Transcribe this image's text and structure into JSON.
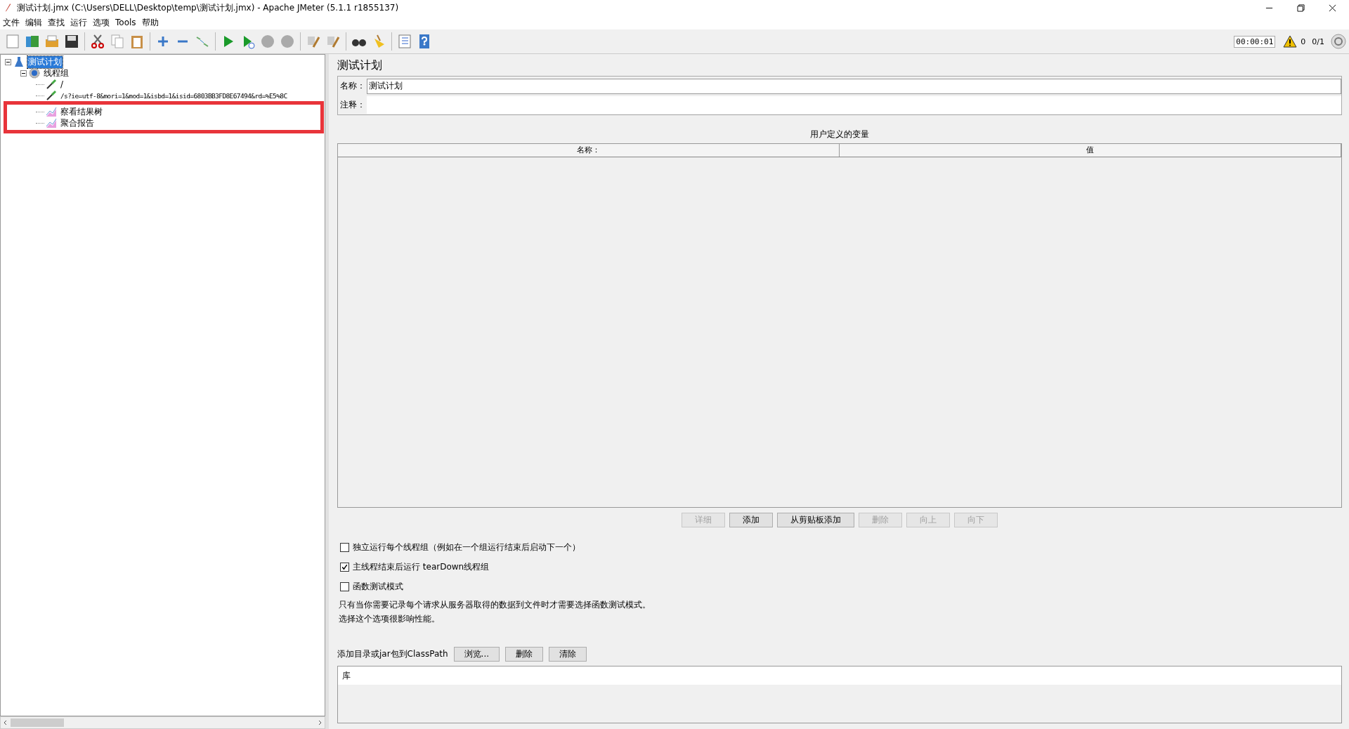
{
  "window": {
    "title": "测试计划.jmx (C:\\Users\\DELL\\Desktop\\temp\\测试计划.jmx) - Apache JMeter (5.1.1 r1855137)"
  },
  "menu": [
    "文件",
    "编辑",
    "查找",
    "运行",
    "选项",
    "Tools",
    "帮助"
  ],
  "status": {
    "timer": "00:00:01",
    "warnings": "0",
    "threads": "0/1"
  },
  "tree": [
    {
      "label": "测试计划",
      "kind": "plan",
      "selected": true,
      "expanded": true,
      "children": [
        {
          "label": "线程组",
          "kind": "threadgroup",
          "selected": false,
          "expanded": true,
          "children": [
            {
              "label": "/",
              "kind": "sampler",
              "selected": false
            },
            {
              "label": "/s?ie=utf-8&mori=1&mod=1&isbd=1&isid=6803BB3FD8E67494&rd=%E5%8C",
              "kind": "sampler",
              "selected": false
            },
            {
              "label": "察看结果树",
              "kind": "listener",
              "selected": false
            },
            {
              "label": "聚合报告",
              "kind": "listener",
              "selected": false
            }
          ]
        }
      ]
    }
  ],
  "panel": {
    "title": "测试计划",
    "name_label": "名称：",
    "name_value": "测试计划",
    "comment_label": "注释：",
    "variables_title": "用户定义的变量",
    "columns": [
      "名称：",
      "值"
    ],
    "buttons": [
      {
        "label": "详细",
        "disabled": true
      },
      {
        "label": "添加",
        "disabled": false
      },
      {
        "label": "从剪贴板添加",
        "disabled": false
      },
      {
        "label": "删除",
        "disabled": true
      },
      {
        "label": "向上",
        "disabled": true
      },
      {
        "label": "向下",
        "disabled": true
      }
    ],
    "options": [
      {
        "label": "独立运行每个线程组（例如在一个组运行结束后启动下一个）",
        "checked": false
      },
      {
        "label": "主线程结束后运行 tearDown线程组",
        "checked": true
      },
      {
        "label": "函数测试模式",
        "checked": false
      }
    ],
    "description": [
      "只有当你需要记录每个请求从服务器取得的数据到文件时才需要选择函数测试模式。",
      "选择这个选项很影响性能。"
    ],
    "classpath_label": "添加目录或jar包到ClassPath",
    "classpath_buttons": [
      "浏览...",
      "删除",
      "清除"
    ],
    "library_column": "库"
  }
}
